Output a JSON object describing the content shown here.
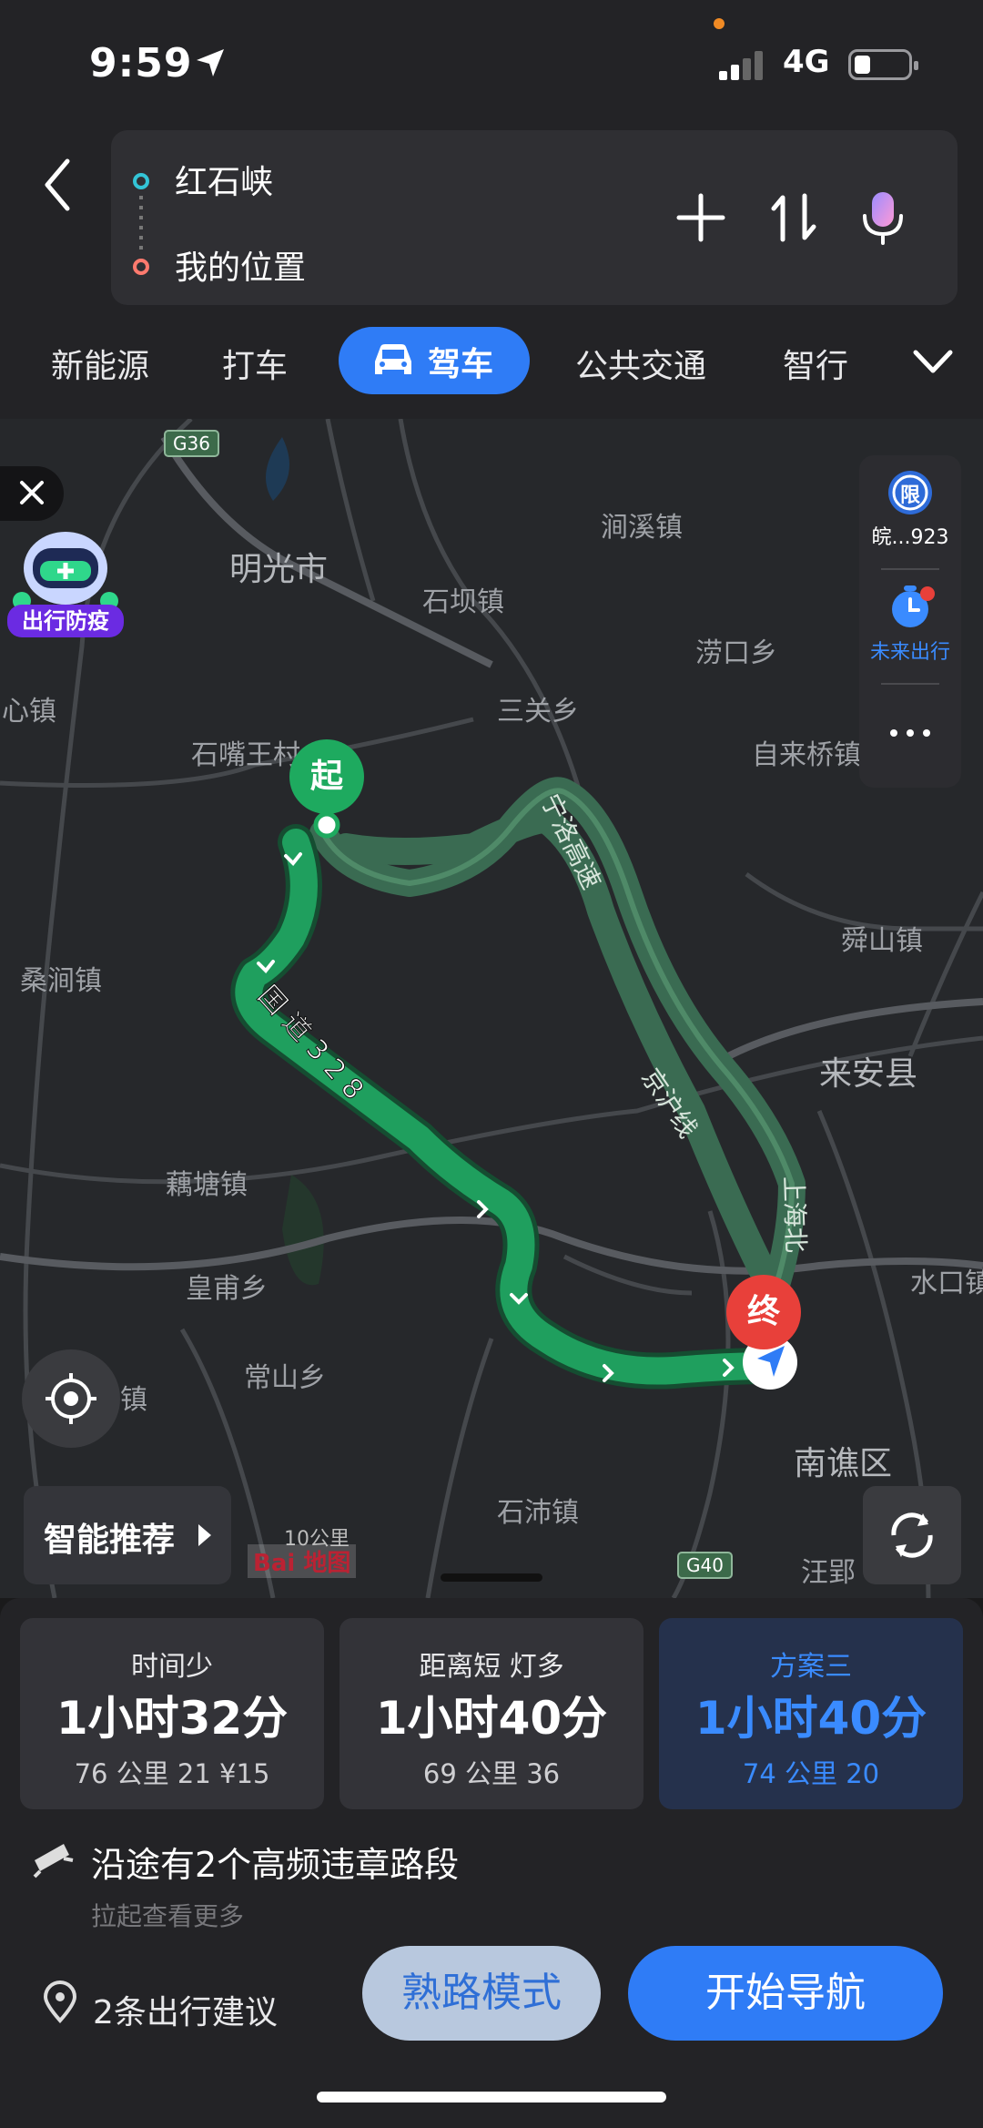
{
  "status_bar": {
    "time": "9:59",
    "network": "4G"
  },
  "route": {
    "from": "红石峡",
    "to": "我的位置"
  },
  "modes": [
    "新能源",
    "打车",
    "驾车",
    "公共交通",
    "智行"
  ],
  "active_mode": "驾车",
  "map": {
    "places": [
      "明光市",
      "涧溪镇",
      "石坝镇",
      "涝口乡",
      "三关乡",
      "心镇",
      "石嘴王村",
      "自来桥镇",
      "桑涧镇",
      "舜山镇",
      "来安县",
      "藕塘镇",
      "皇甫乡",
      "常山乡",
      "镇",
      "南谯区",
      "石沛镇",
      "汪郢",
      "水口镇"
    ],
    "road_labels": [
      "国道328",
      "宁洛高速",
      "京沪线",
      "上海北"
    ],
    "highway_tags": [
      "G36",
      "G40"
    ],
    "restriction_badge": "限",
    "plate_text": "皖...923",
    "future_trip_label": "未来出行",
    "promo_label": "出行防疫",
    "start_marker": "起",
    "end_marker": "终",
    "smart_recommend": "智能推荐",
    "scale": "10公里",
    "logo": "Bai 地图"
  },
  "plans": [
    {
      "title": "时间少",
      "duration": "1小时32分",
      "meta": "76 公里  21 ¥15"
    },
    {
      "title": "距离短  灯多",
      "duration": "1小时40分",
      "meta": "69 公里  36"
    },
    {
      "title": "方案三",
      "duration": "1小时40分",
      "meta": "74 公里  20"
    }
  ],
  "warning": {
    "text": "沿途有2个高频违章路段",
    "subtext": "拉起查看更多"
  },
  "suggestions": "2条出行建议",
  "buttons": {
    "familiar": "熟路模式",
    "start": "开始导航"
  },
  "colors": {
    "accent": "#2f7cf6",
    "route": "#1f9f5e",
    "alt_route": "#3e6d55",
    "start": "#1eaa5f",
    "end": "#e8403a"
  }
}
